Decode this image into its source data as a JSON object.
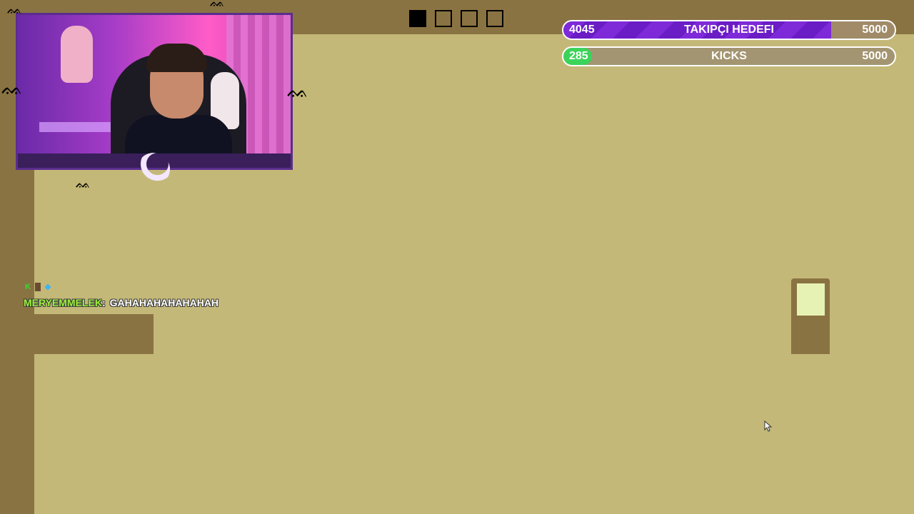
{
  "level_tracker": {
    "boxes": [
      {
        "filled": true
      },
      {
        "filled": false
      },
      {
        "filled": false
      },
      {
        "filled": false
      }
    ]
  },
  "goals": [
    {
      "current": "4045",
      "label": "TAKIPÇI HEDEFI",
      "target": "5000",
      "fraction": 0.809,
      "color": "#7e2ad9"
    },
    {
      "current": "285",
      "label": "KICKS",
      "target": "5000",
      "fraction": 0.057,
      "color": "#3cd35a"
    }
  ],
  "chat": {
    "username": "MERYEMMELEK",
    "separator": ":",
    "message": "GAHAHAHAHAHAHAH",
    "badges": [
      "K",
      "",
      "◆"
    ]
  },
  "colors": {
    "background": "#c4b878",
    "wall": "#8a7342",
    "door_window": "#e6f2b4",
    "webcam_border": "#5a2d8e"
  },
  "icons": [
    "bat-icon",
    "moon-icon",
    "door-icon",
    "cursor-icon"
  ]
}
